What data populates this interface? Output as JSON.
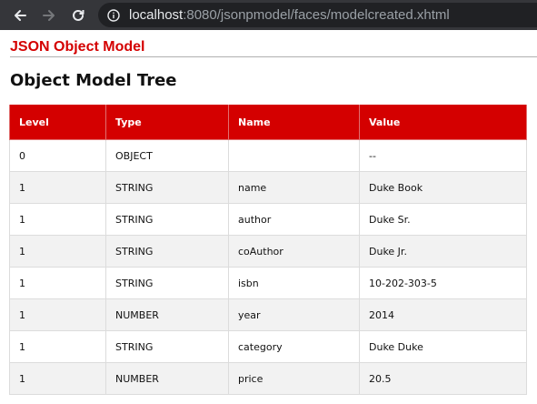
{
  "browser": {
    "url_host": "localhost",
    "url_rest": ":8080/jsonpmodel/faces/modelcreated.xhtml"
  },
  "app_title": "JSON Object Model",
  "page_title": "Object Model Tree",
  "table": {
    "headers": [
      "Level",
      "Type",
      "Name",
      "Value"
    ],
    "rows": [
      [
        "0",
        "OBJECT",
        "",
        "--"
      ],
      [
        "1",
        "STRING",
        "name",
        "Duke Book"
      ],
      [
        "1",
        "STRING",
        "author",
        "Duke Sr."
      ],
      [
        "1",
        "STRING",
        "coAuthor",
        "Duke Jr."
      ],
      [
        "1",
        "STRING",
        "isbn",
        "10-202-303-5"
      ],
      [
        "1",
        "NUMBER",
        "year",
        "2014"
      ],
      [
        "1",
        "STRING",
        "category",
        "Duke Duke"
      ],
      [
        "1",
        "NUMBER",
        "price",
        "20.5"
      ]
    ]
  },
  "colors": {
    "accent": "#d40000",
    "row_alt": "#f2f2f2",
    "browser_chrome": "#35363a"
  },
  "icons": {
    "back": "back-arrow-icon",
    "forward": "forward-arrow-icon",
    "reload": "reload-icon",
    "site_info": "info-icon"
  }
}
